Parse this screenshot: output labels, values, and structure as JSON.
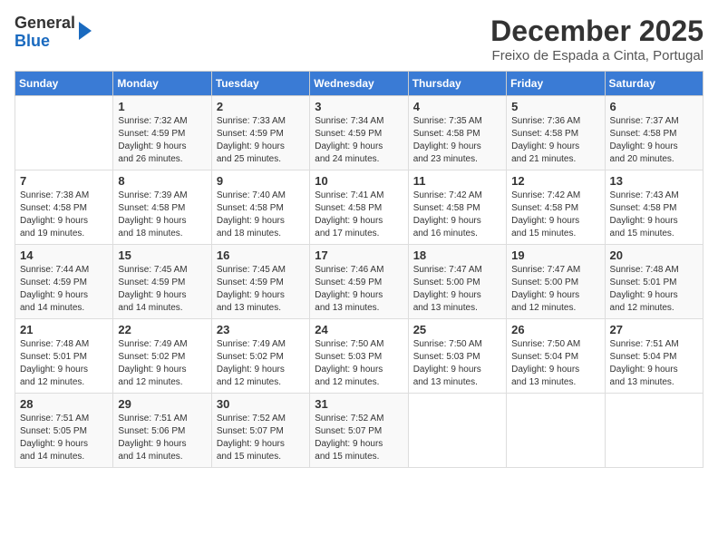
{
  "logo": {
    "general": "General",
    "blue": "Blue"
  },
  "title": "December 2025",
  "subtitle": "Freixo de Espada a Cinta, Portugal",
  "days_header": [
    "Sunday",
    "Monday",
    "Tuesday",
    "Wednesday",
    "Thursday",
    "Friday",
    "Saturday"
  ],
  "weeks": [
    [
      {
        "day": "",
        "sunrise": "",
        "sunset": "",
        "daylight": ""
      },
      {
        "day": "1",
        "sunrise": "7:32 AM",
        "sunset": "4:59 PM",
        "daylight": "9 hours and 26 minutes."
      },
      {
        "day": "2",
        "sunrise": "7:33 AM",
        "sunset": "4:59 PM",
        "daylight": "9 hours and 25 minutes."
      },
      {
        "day": "3",
        "sunrise": "7:34 AM",
        "sunset": "4:59 PM",
        "daylight": "9 hours and 24 minutes."
      },
      {
        "day": "4",
        "sunrise": "7:35 AM",
        "sunset": "4:58 PM",
        "daylight": "9 hours and 23 minutes."
      },
      {
        "day": "5",
        "sunrise": "7:36 AM",
        "sunset": "4:58 PM",
        "daylight": "9 hours and 21 minutes."
      },
      {
        "day": "6",
        "sunrise": "7:37 AM",
        "sunset": "4:58 PM",
        "daylight": "9 hours and 20 minutes."
      }
    ],
    [
      {
        "day": "7",
        "sunrise": "7:38 AM",
        "sunset": "4:58 PM",
        "daylight": "9 hours and 19 minutes."
      },
      {
        "day": "8",
        "sunrise": "7:39 AM",
        "sunset": "4:58 PM",
        "daylight": "9 hours and 18 minutes."
      },
      {
        "day": "9",
        "sunrise": "7:40 AM",
        "sunset": "4:58 PM",
        "daylight": "9 hours and 18 minutes."
      },
      {
        "day": "10",
        "sunrise": "7:41 AM",
        "sunset": "4:58 PM",
        "daylight": "9 hours and 17 minutes."
      },
      {
        "day": "11",
        "sunrise": "7:42 AM",
        "sunset": "4:58 PM",
        "daylight": "9 hours and 16 minutes."
      },
      {
        "day": "12",
        "sunrise": "7:42 AM",
        "sunset": "4:58 PM",
        "daylight": "9 hours and 15 minutes."
      },
      {
        "day": "13",
        "sunrise": "7:43 AM",
        "sunset": "4:58 PM",
        "daylight": "9 hours and 15 minutes."
      }
    ],
    [
      {
        "day": "14",
        "sunrise": "7:44 AM",
        "sunset": "4:59 PM",
        "daylight": "9 hours and 14 minutes."
      },
      {
        "day": "15",
        "sunrise": "7:45 AM",
        "sunset": "4:59 PM",
        "daylight": "9 hours and 14 minutes."
      },
      {
        "day": "16",
        "sunrise": "7:45 AM",
        "sunset": "4:59 PM",
        "daylight": "9 hours and 13 minutes."
      },
      {
        "day": "17",
        "sunrise": "7:46 AM",
        "sunset": "4:59 PM",
        "daylight": "9 hours and 13 minutes."
      },
      {
        "day": "18",
        "sunrise": "7:47 AM",
        "sunset": "5:00 PM",
        "daylight": "9 hours and 13 minutes."
      },
      {
        "day": "19",
        "sunrise": "7:47 AM",
        "sunset": "5:00 PM",
        "daylight": "9 hours and 12 minutes."
      },
      {
        "day": "20",
        "sunrise": "7:48 AM",
        "sunset": "5:01 PM",
        "daylight": "9 hours and 12 minutes."
      }
    ],
    [
      {
        "day": "21",
        "sunrise": "7:48 AM",
        "sunset": "5:01 PM",
        "daylight": "9 hours and 12 minutes."
      },
      {
        "day": "22",
        "sunrise": "7:49 AM",
        "sunset": "5:02 PM",
        "daylight": "9 hours and 12 minutes."
      },
      {
        "day": "23",
        "sunrise": "7:49 AM",
        "sunset": "5:02 PM",
        "daylight": "9 hours and 12 minutes."
      },
      {
        "day": "24",
        "sunrise": "7:50 AM",
        "sunset": "5:03 PM",
        "daylight": "9 hours and 12 minutes."
      },
      {
        "day": "25",
        "sunrise": "7:50 AM",
        "sunset": "5:03 PM",
        "daylight": "9 hours and 13 minutes."
      },
      {
        "day": "26",
        "sunrise": "7:50 AM",
        "sunset": "5:04 PM",
        "daylight": "9 hours and 13 minutes."
      },
      {
        "day": "27",
        "sunrise": "7:51 AM",
        "sunset": "5:04 PM",
        "daylight": "9 hours and 13 minutes."
      }
    ],
    [
      {
        "day": "28",
        "sunrise": "7:51 AM",
        "sunset": "5:05 PM",
        "daylight": "9 hours and 14 minutes."
      },
      {
        "day": "29",
        "sunrise": "7:51 AM",
        "sunset": "5:06 PM",
        "daylight": "9 hours and 14 minutes."
      },
      {
        "day": "30",
        "sunrise": "7:52 AM",
        "sunset": "5:07 PM",
        "daylight": "9 hours and 15 minutes."
      },
      {
        "day": "31",
        "sunrise": "7:52 AM",
        "sunset": "5:07 PM",
        "daylight": "9 hours and 15 minutes."
      },
      {
        "day": "",
        "sunrise": "",
        "sunset": "",
        "daylight": ""
      },
      {
        "day": "",
        "sunrise": "",
        "sunset": "",
        "daylight": ""
      },
      {
        "day": "",
        "sunrise": "",
        "sunset": "",
        "daylight": ""
      }
    ]
  ],
  "labels": {
    "sunrise": "Sunrise:",
    "sunset": "Sunset:",
    "daylight": "Daylight:"
  }
}
